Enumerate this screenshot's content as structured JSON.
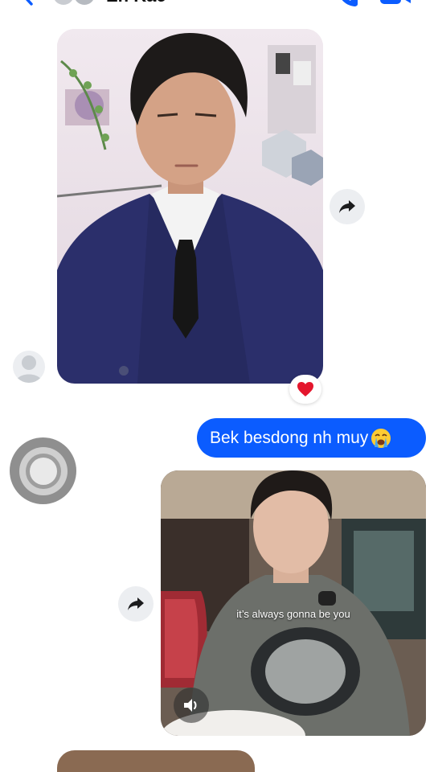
{
  "header": {
    "contact_name": "Eh Kae",
    "back_icon": "chevron-left-icon",
    "call_icon": "phone-icon",
    "video_icon": "video-camera-icon"
  },
  "messages": {
    "photo": {
      "reaction": "❤️",
      "forward_icon": "share-arrow-icon"
    },
    "sent_text": "Bek besdong nh muy",
    "sent_emoji": "crying-face-emoji",
    "video": {
      "caption": "it’s always gonna be you",
      "sound_icon": "speaker-icon",
      "forward_icon": "share-arrow-icon"
    }
  },
  "colors": {
    "sent_bubble": "#0b5cff",
    "icon_blue": "#0b5cff",
    "reaction_red": "#e4162d"
  }
}
